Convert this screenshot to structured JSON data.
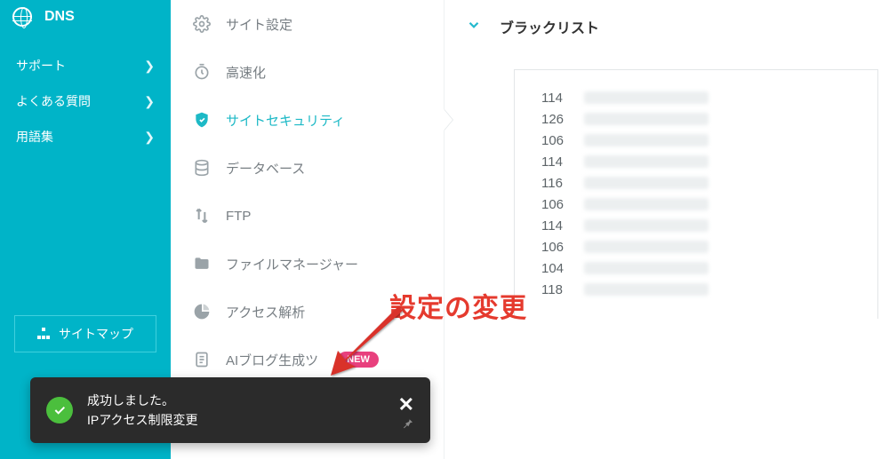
{
  "sidebar": {
    "dns_label": "DNS",
    "items": [
      {
        "label": "サポート"
      },
      {
        "label": "よくある質問"
      },
      {
        "label": "用語集"
      }
    ],
    "sitemap_label": "サイトマップ"
  },
  "nav2": {
    "items": [
      {
        "icon": "gear",
        "label": "サイト設定"
      },
      {
        "icon": "speed",
        "label": "高速化"
      },
      {
        "icon": "shield",
        "label": "サイトセキュリティ",
        "active": true
      },
      {
        "icon": "database",
        "label": "データベース"
      },
      {
        "icon": "ftp",
        "label": "FTP"
      },
      {
        "icon": "folder",
        "label": "ファイルマネージャー"
      },
      {
        "icon": "chart",
        "label": "アクセス解析"
      },
      {
        "icon": "ai",
        "label": "AIブログ生成ツ",
        "badge": "NEW"
      }
    ]
  },
  "main": {
    "section_title": "ブラックリスト",
    "ip_first_octets": [
      "114",
      "126",
      "106",
      "114",
      "116",
      "106",
      "114",
      "106",
      "104",
      "118"
    ]
  },
  "annotation": {
    "text": "設定の変更"
  },
  "toast": {
    "title": "成功しました。",
    "body": "IPアクセス制限変更"
  }
}
